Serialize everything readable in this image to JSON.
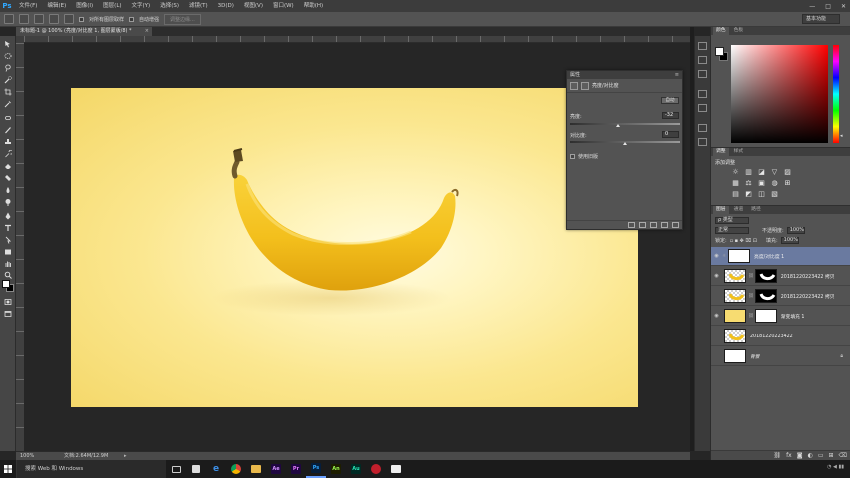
{
  "app": {
    "logo": "Ps",
    "menus": [
      "文件(F)",
      "编辑(E)",
      "图像(I)",
      "图层(L)",
      "文字(Y)",
      "选择(S)",
      "滤镜(T)",
      "3D(D)",
      "视图(V)",
      "窗口(W)",
      "帮助(H)"
    ],
    "window_controls": [
      "—",
      "□",
      "✕"
    ]
  },
  "options_bar": {
    "check1_label": "对所有图层取样",
    "check2_label": "自动增强",
    "refine_button": "调整边缘...",
    "workspace": "基本功能"
  },
  "document": {
    "tab_title": "未标题-1 @ 100% (亮度/对比度 1, 图层蒙版/8) *",
    "tab_close": "×"
  },
  "status_bar": {
    "zoom": "100%",
    "doc_info": "文档:2.64M/12.9M",
    "arrow": "▸"
  },
  "properties_panel": {
    "title": "属性",
    "adjustment_name": "亮度/对比度",
    "auto_button": "自动",
    "brightness_label": "亮度:",
    "brightness_value": "-32",
    "brightness_fraction": 0.44,
    "contrast_label": "对比度:",
    "contrast_value": "0",
    "contrast_fraction": 0.5,
    "legacy_label": "使用旧版"
  },
  "color_panel": {
    "tabs": [
      "颜色",
      "色板"
    ],
    "hue_marker": "◂"
  },
  "adjustments_panel": {
    "tabs": [
      "调整",
      "样式"
    ],
    "title": "添加调整",
    "icons": [
      "☼",
      "▥",
      "◪",
      "▽",
      "▨",
      "▦",
      "⚖",
      "▣",
      "◍",
      "⊞",
      "▤",
      "◩",
      "◫",
      "▧"
    ]
  },
  "layers_panel": {
    "tabs": [
      "图层",
      "通道",
      "路径"
    ],
    "filter_label": "ρ 类型",
    "blend_mode": "正常",
    "opacity_label": "不透明度:",
    "opacity_value": "100%",
    "lock_label": "锁定:",
    "fill_label": "填充:",
    "fill_value": "100%",
    "layers": [
      {
        "name": "亮度/对比度 1",
        "selected": true
      },
      {
        "name": "20181220223422 拷贝"
      },
      {
        "name": "20181220223422 拷贝"
      },
      {
        "name": "渐变填充 1"
      },
      {
        "name": "20181220223422"
      },
      {
        "name": "背景"
      }
    ]
  },
  "taskbar": {
    "search_placeholder": "搜索 Web 和 Windows"
  }
}
